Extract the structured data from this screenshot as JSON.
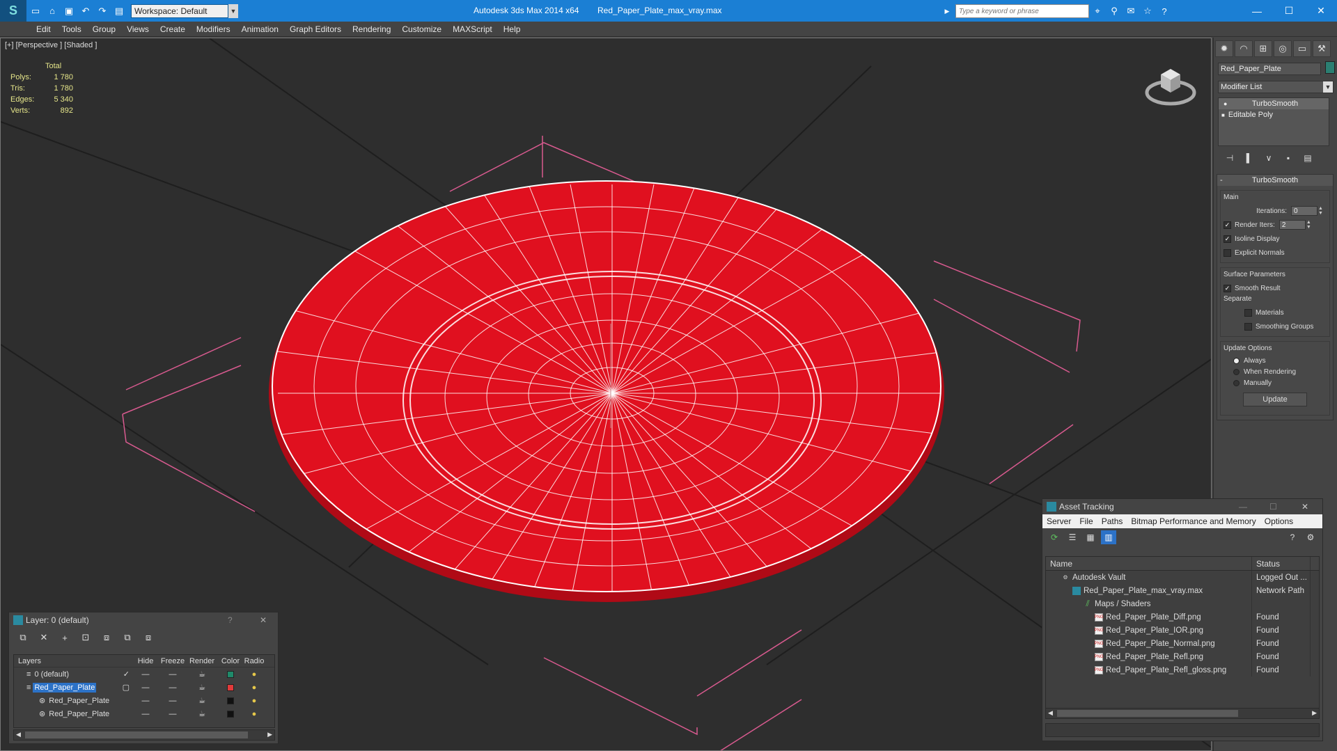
{
  "titlebar": {
    "workspace": "Workspace: Default",
    "app_title": "Autodesk 3ds Max  2014 x64",
    "file_title": "Red_Paper_Plate_max_vray.max",
    "search_placeholder": "Type a keyword or phrase"
  },
  "menu": [
    "Edit",
    "Tools",
    "Group",
    "Views",
    "Create",
    "Modifiers",
    "Animation",
    "Graph Editors",
    "Rendering",
    "Customize",
    "MAXScript",
    "Help"
  ],
  "viewport": {
    "label": "[+] [Perspective ] [Shaded ]",
    "stats_header": "Total",
    "stats": [
      {
        "label": "Polys:",
        "value": "1 780"
      },
      {
        "label": "Tris:",
        "value": "1 780"
      },
      {
        "label": "Edges:",
        "value": "5 340"
      },
      {
        "label": "Verts:",
        "value": "892"
      }
    ]
  },
  "command_panel": {
    "object_name": "Red_Paper_Plate",
    "modifier_list": "Modifier List",
    "stack": [
      "TurboSmooth",
      "Editable Poly"
    ],
    "rollout_title": "TurboSmooth",
    "main_label": "Main",
    "iterations_label": "Iterations:",
    "iterations_value": "0",
    "render_iters_label": "Render Iters:",
    "render_iters_value": "2",
    "isoline_label": "Isoline Display",
    "explicit_normals_label": "Explicit Normals",
    "surface_params_label": "Surface Parameters",
    "smooth_result_label": "Smooth Result",
    "separate_label": "Separate",
    "materials_label": "Materials",
    "smoothing_groups_label": "Smoothing Groups",
    "update_options_label": "Update Options",
    "always_label": "Always",
    "when_rendering_label": "When Rendering",
    "manually_label": "Manually",
    "update_button": "Update"
  },
  "layer_dialog": {
    "title": "Layer: 0 (default)",
    "help": "?",
    "columns": [
      "Layers",
      "Hide",
      "Freeze",
      "Render",
      "Color",
      "Radio"
    ],
    "rows": [
      {
        "name": "0 (default)",
        "color": "#1f8a6a"
      },
      {
        "name": "Red_Paper_Plate",
        "color": "#e23a3a"
      },
      {
        "name": "Red_Paper_Plate",
        "color": "#111111"
      },
      {
        "name": "Red_Paper_Plate",
        "color": "#111111"
      }
    ]
  },
  "asset_dialog": {
    "title": "Asset Tracking",
    "menu": [
      "Server",
      "File",
      "Paths",
      "Bitmap Performance and Memory",
      "Options"
    ],
    "columns": [
      "Name",
      "Status"
    ],
    "rows": [
      {
        "name": "Autodesk Vault",
        "status": "Logged Out ..."
      },
      {
        "name": "Red_Paper_Plate_max_vray.max",
        "status": "Network Path"
      },
      {
        "name": "Maps / Shaders",
        "status": ""
      },
      {
        "name": "Red_Paper_Plate_Diff.png",
        "status": "Found"
      },
      {
        "name": "Red_Paper_Plate_IOR.png",
        "status": "Found"
      },
      {
        "name": "Red_Paper_Plate_Normal.png",
        "status": "Found"
      },
      {
        "name": "Red_Paper_Plate_Refl.png",
        "status": "Found"
      },
      {
        "name": "Red_Paper_Plate_Refl_gloss.png",
        "status": "Found"
      }
    ]
  },
  "colors": {
    "titlebar": "#1b7fd4",
    "plate": "#e0101f",
    "selection": "#2c72c7"
  }
}
